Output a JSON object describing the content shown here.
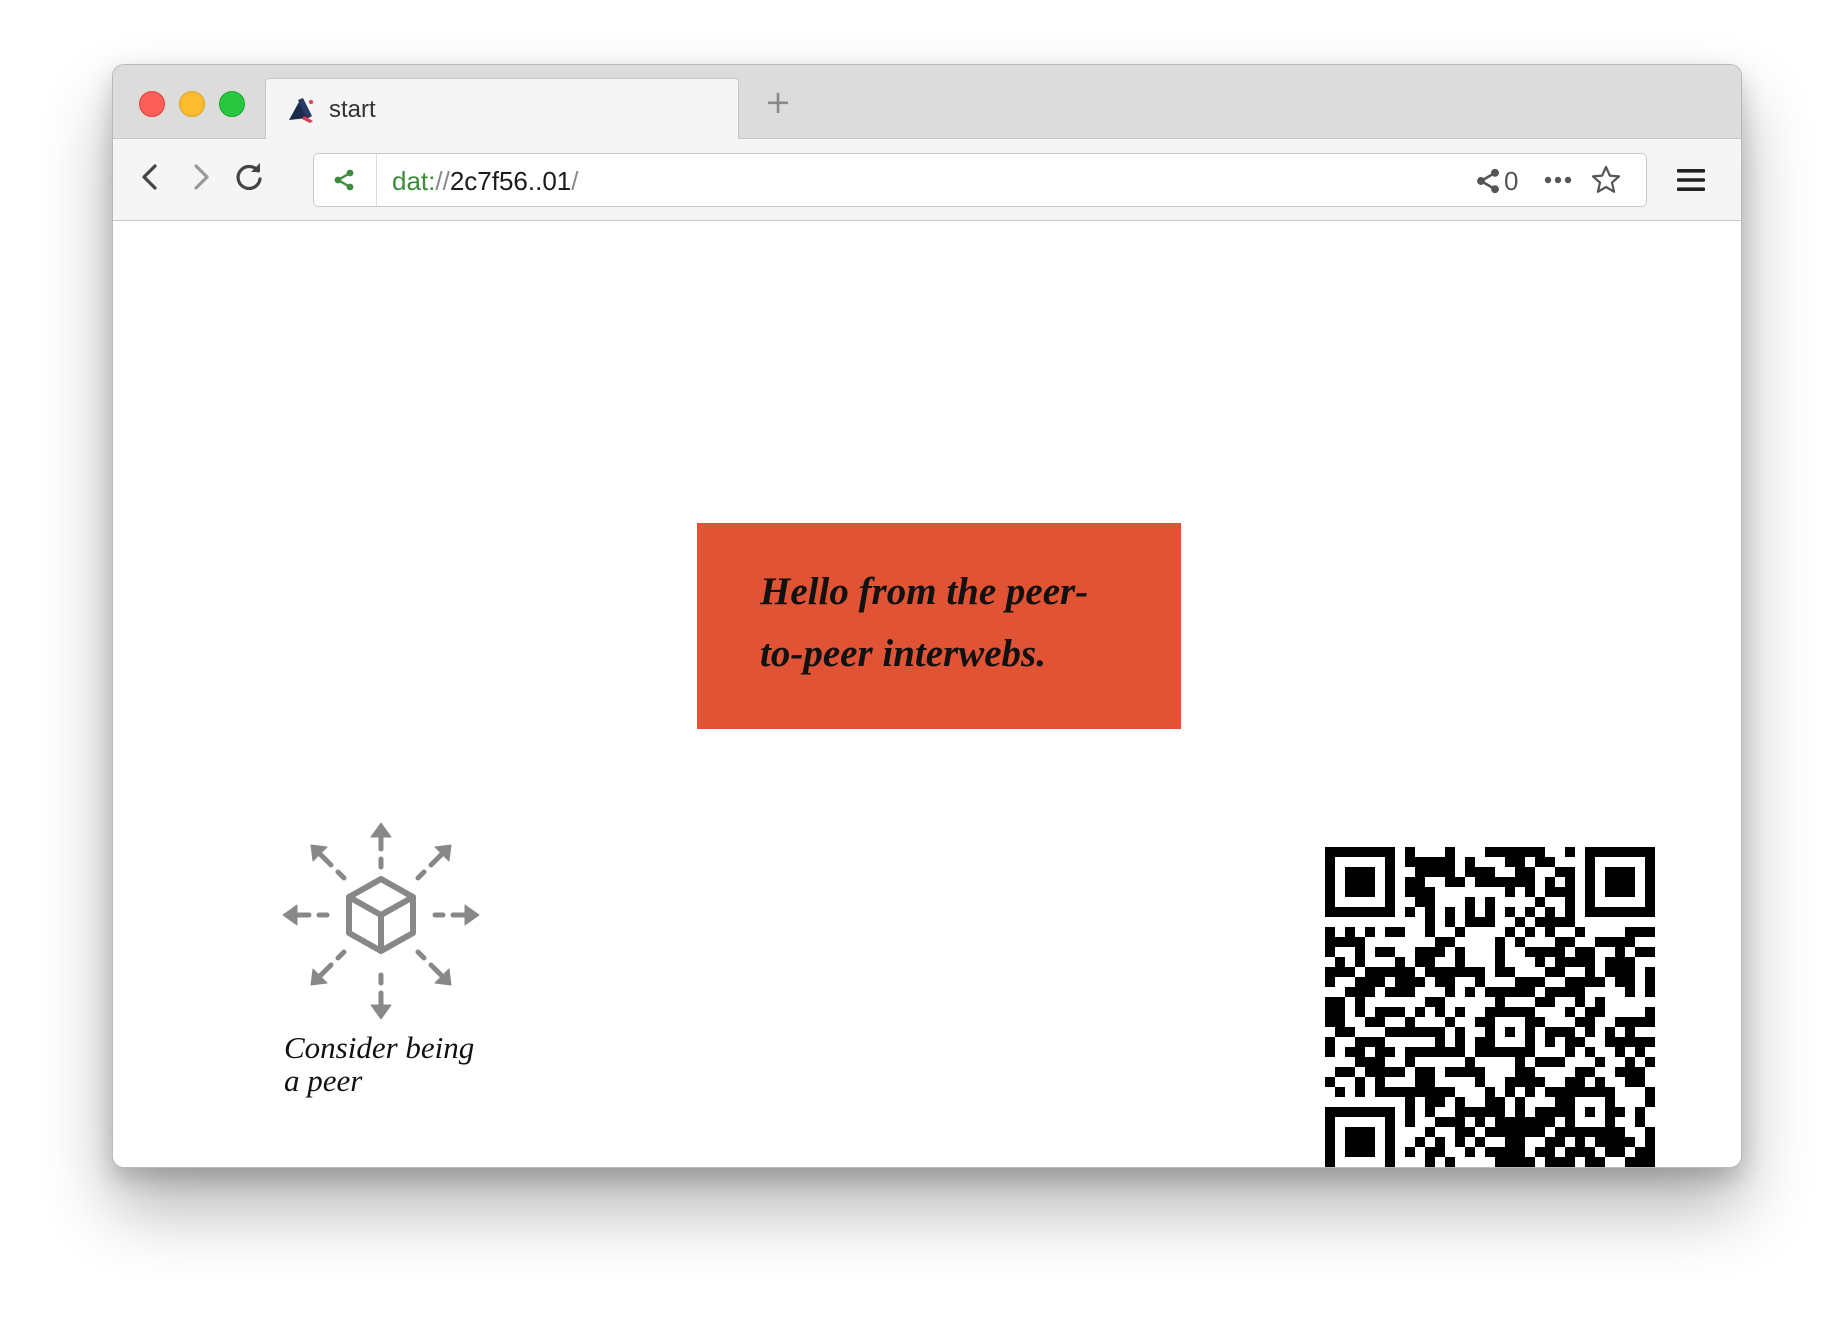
{
  "window": {
    "traffic_lights": [
      "close",
      "minimize",
      "maximize"
    ]
  },
  "tab": {
    "title": "start",
    "favicon": "beaker-icon",
    "new_tab_label": "+"
  },
  "toolbar": {
    "back_icon": "chevron-left-icon",
    "forward_icon": "chevron-right-icon",
    "reload_icon": "reload-icon",
    "menu_icon": "hamburger-menu-icon"
  },
  "url_bar": {
    "scheme": "dat:",
    "separator": "//",
    "host": "2c7f56..01",
    "trailing": "/",
    "peer_count": "0",
    "more_icon": "ellipsis-icon",
    "bookmark_icon": "star-icon"
  },
  "page": {
    "hello_line1": "Hello from the peer-",
    "hello_line2": "to-peer interwebs.",
    "caption_line1": "Consider being",
    "caption_line2": "a peer",
    "accent_color": "#e05435",
    "graphic_icon": "distribute-box-icon",
    "qr_icon": "qr-code"
  }
}
